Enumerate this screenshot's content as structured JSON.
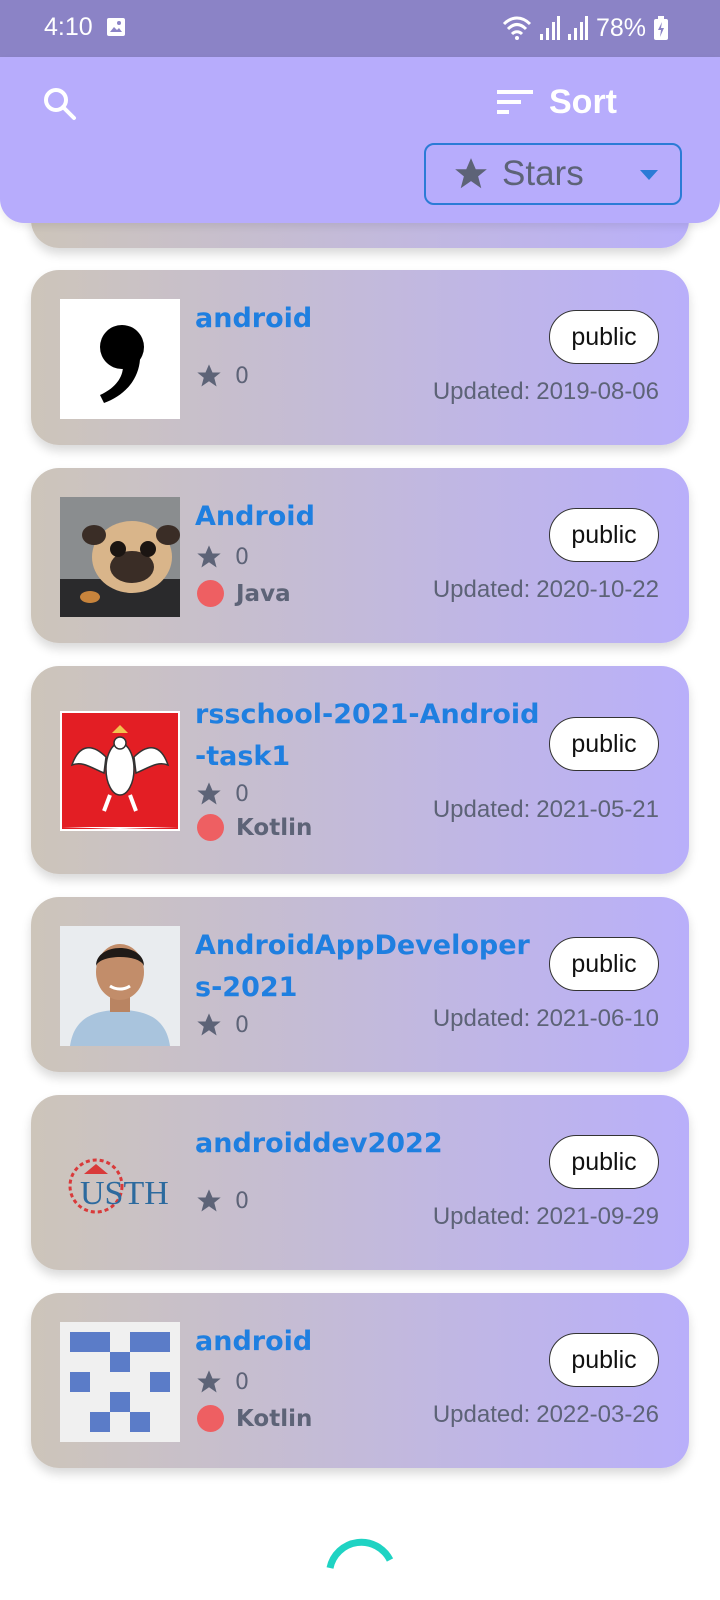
{
  "status_bar": {
    "time": "4:10",
    "battery_percent": "78%",
    "icons": [
      "image-icon",
      "wifi-icon",
      "signal-icon",
      "signal-icon",
      "battery-charging-icon"
    ]
  },
  "header": {
    "search_icon": "search-icon",
    "sort_label": "Sort",
    "sort_icon": "sort-icon",
    "sort_select": {
      "value": "Stars",
      "icon": "star-icon"
    }
  },
  "repos": [
    {
      "name": "android",
      "stars": "0",
      "language": "",
      "visibility": "public",
      "updated_label": "Updated:",
      "updated_date": "2019-08-06",
      "avatar": "comma-logo"
    },
    {
      "name": "Android",
      "stars": "0",
      "language": "Java",
      "visibility": "public",
      "updated_label": "Updated:",
      "updated_date": "2020-10-22",
      "avatar": "pug-photo"
    },
    {
      "name": "rsschool-2021-Android-task1",
      "stars": "0",
      "language": "Kotlin",
      "visibility": "public",
      "updated_label": "Updated:",
      "updated_date": "2021-05-21",
      "avatar": "eagle-emblem"
    },
    {
      "name": "AndroidAppDevelopers-2021",
      "stars": "0",
      "language": "",
      "visibility": "public",
      "updated_label": "Updated:",
      "updated_date": "2021-06-10",
      "avatar": "person-photo"
    },
    {
      "name": "androiddev2022",
      "stars": "0",
      "language": "",
      "visibility": "public",
      "updated_label": "Updated:",
      "updated_date": "2021-09-29",
      "avatar": "usth-logo",
      "avatar_text": "USTH"
    },
    {
      "name": "android",
      "stars": "0",
      "language": "Kotlin",
      "visibility": "public",
      "updated_label": "Updated:",
      "updated_date": "2022-03-26",
      "avatar": "identicon"
    }
  ],
  "colors": {
    "status_bar": "#8b83c6",
    "header": "#b7acfc",
    "repo_name": "#1f7fe0",
    "language_dot": "#ee5f62",
    "spinner": "#1fd3c3"
  }
}
